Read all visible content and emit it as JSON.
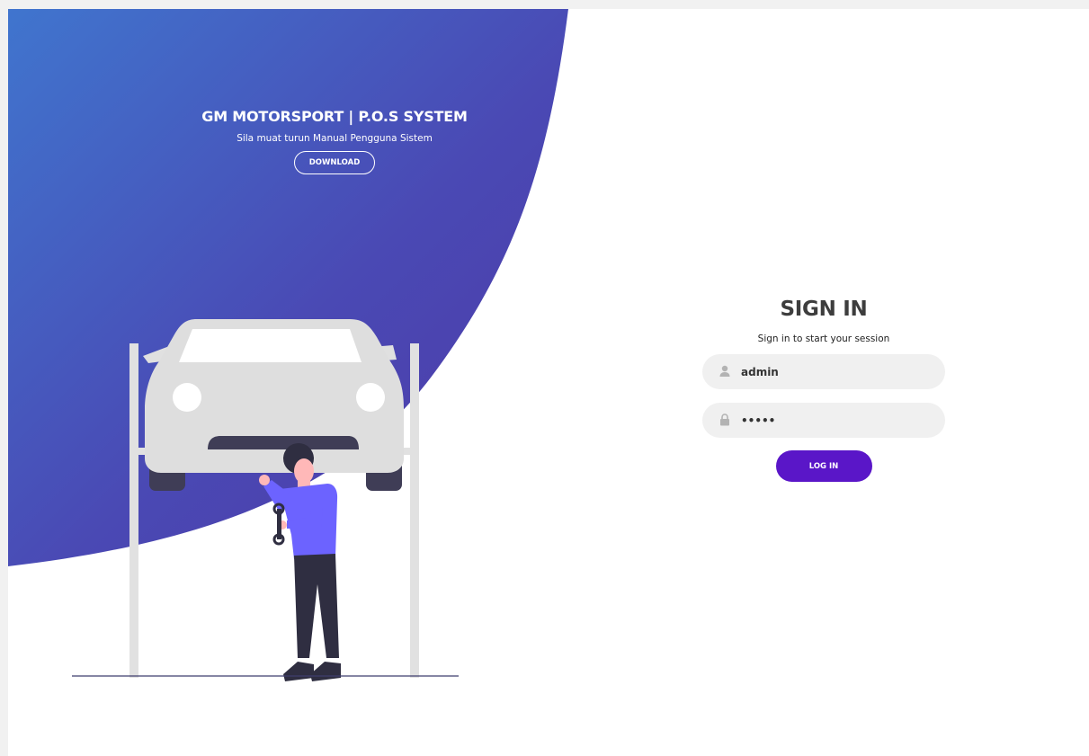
{
  "hero": {
    "title": "GM MOTORSPORT | P.O.S SYSTEM",
    "subtitle": "Sila muat turun Manual Pengguna Sistem",
    "download_label": "DOWNLOAD"
  },
  "login": {
    "title": "SIGN IN",
    "subtitle": "Sign in to start your session",
    "username_value": "admin",
    "password_value": "admin",
    "login_label": "LOG IN",
    "username_icon": "user-icon",
    "password_icon": "lock-icon"
  },
  "illustration": {
    "name": "mechanic-under-car-lift"
  },
  "colors": {
    "gradient_start": "#4075ce",
    "gradient_end": "#4e39a8",
    "button": "#5a16c8",
    "input_bg": "#f0f0f0",
    "shirt": "#6c63ff",
    "pants": "#2f2e41"
  }
}
